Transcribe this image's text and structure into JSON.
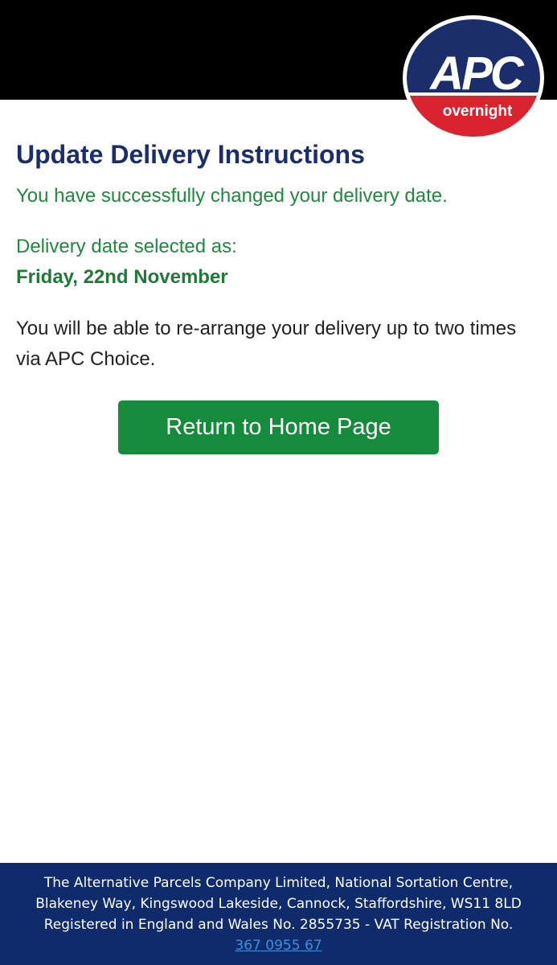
{
  "header": {
    "logo_text": "APC",
    "logo_subtext": "overnight"
  },
  "main": {
    "title": "Update Delivery Instructions",
    "success_message": "You have successfully changed your delivery date.",
    "selected_label": "Delivery date selected as:",
    "selected_date": "Friday, 22nd November",
    "info_text": "You will be able to re-arrange your delivery up to two times via APC Choice.",
    "home_button_label": "Return to Home Page"
  },
  "footer": {
    "line1": "The Alternative Parcels Company Limited, National Sortation Centre,",
    "line2": "Blakeney Way, Kingswood Lakeside, Cannock, Staffordshire, WS11 8LD",
    "line3": "Registered in England and Wales No. 2855735 - VAT Registration No.",
    "vat_link": "367 0955 67"
  },
  "colors": {
    "brand_navy": "#1b2e6b",
    "brand_red": "#d9232e",
    "success_green": "#1e8a3e",
    "button_green": "#168b3c",
    "footer_bg": "#0f2b6b",
    "link_blue": "#3d8fe0"
  }
}
